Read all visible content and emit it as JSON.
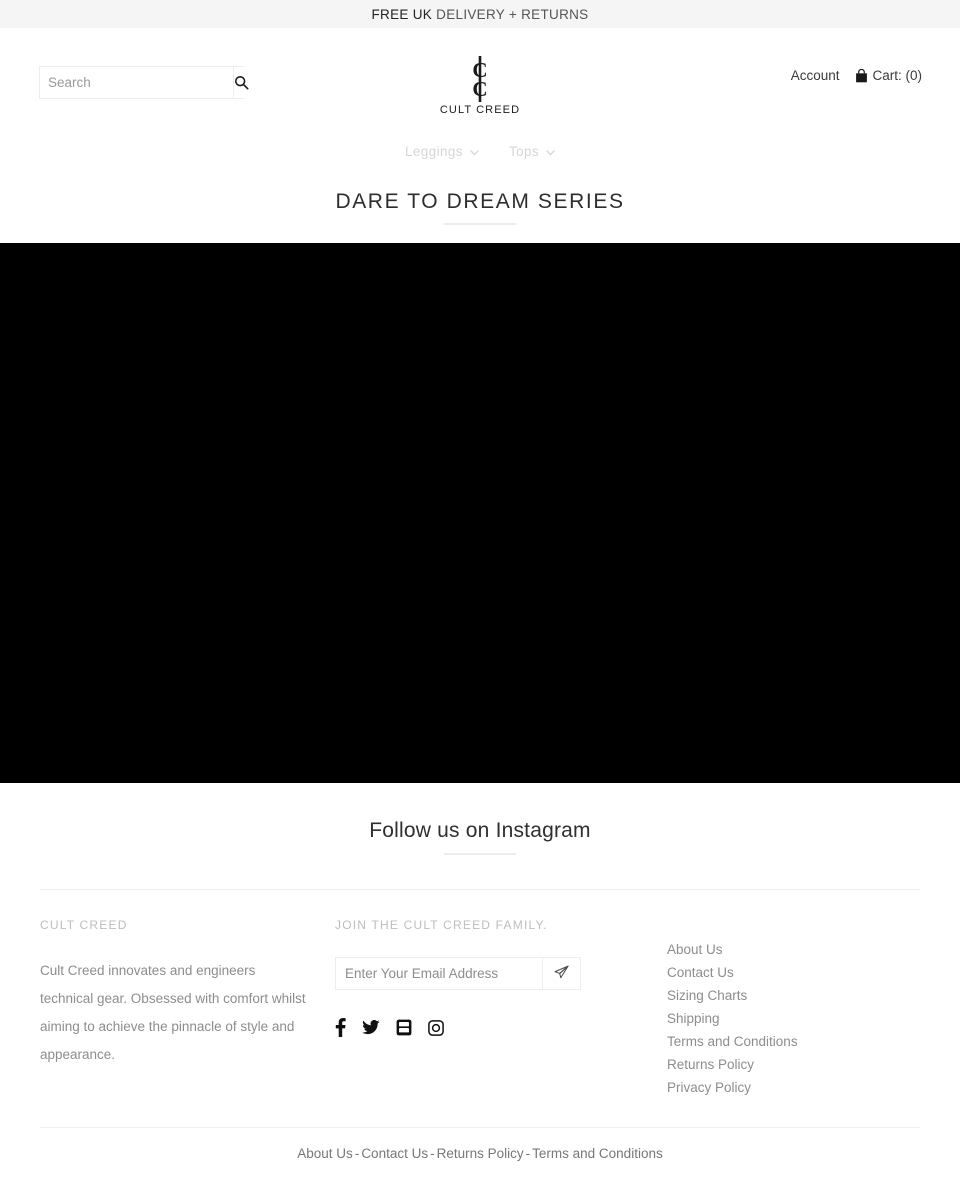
{
  "announcement": {
    "strong": "FREE UK",
    "rest": " DELIVERY + RETURNS"
  },
  "header": {
    "search": {
      "placeholder": "Search",
      "value": "",
      "icon": "search-icon"
    },
    "logo": {
      "wordmark": "CULT CREED",
      "mark": "cc-monogram-icon"
    },
    "account_label": "Account",
    "cart_label": "Cart: (0)",
    "cart_icon": "shopping-bag-icon"
  },
  "nav": {
    "items": [
      {
        "label": "Leggings",
        "icon": "chevron-down-icon"
      },
      {
        "label": "Tops",
        "icon": "chevron-down-icon"
      }
    ]
  },
  "page": {
    "title": "DARE TO DREAM SERIES"
  },
  "hero": {
    "background_color": "#000000"
  },
  "instagram": {
    "heading": "Follow us on Instagram"
  },
  "footer": {
    "about": {
      "heading": "CULT CREED",
      "body": "Cult Creed innovates and engineers technical gear. Obsessed with comfort whilst aiming to achieve the pinnacle of style and appearance."
    },
    "newsletter": {
      "heading": "JOIN THE CULT CREED FAMILY.",
      "placeholder": "Enter Your Email Address",
      "value": "",
      "submit_icon": "paper-plane-icon"
    },
    "social": [
      {
        "name": "facebook-icon",
        "label": "Facebook"
      },
      {
        "name": "twitter-icon",
        "label": "Twitter"
      },
      {
        "name": "youtube-icon",
        "label": "YouTube"
      },
      {
        "name": "instagram-icon",
        "label": "Instagram"
      }
    ],
    "links": [
      "About Us",
      "Contact Us",
      "Sizing Charts",
      "Shipping",
      "Terms and Conditions",
      "Returns Policy",
      "Privacy Policy"
    ],
    "bottom_links": [
      "About Us",
      "Contact Us",
      "Returns Policy",
      "Terms and Conditions"
    ],
    "bottom_separator": "-"
  },
  "colors": {
    "announce_bg": "#f5f5f5",
    "hero_bg": "#000000",
    "muted_text": "#8d8d8d",
    "nav_text": "#d6d6d6",
    "rule": "#ececec"
  }
}
